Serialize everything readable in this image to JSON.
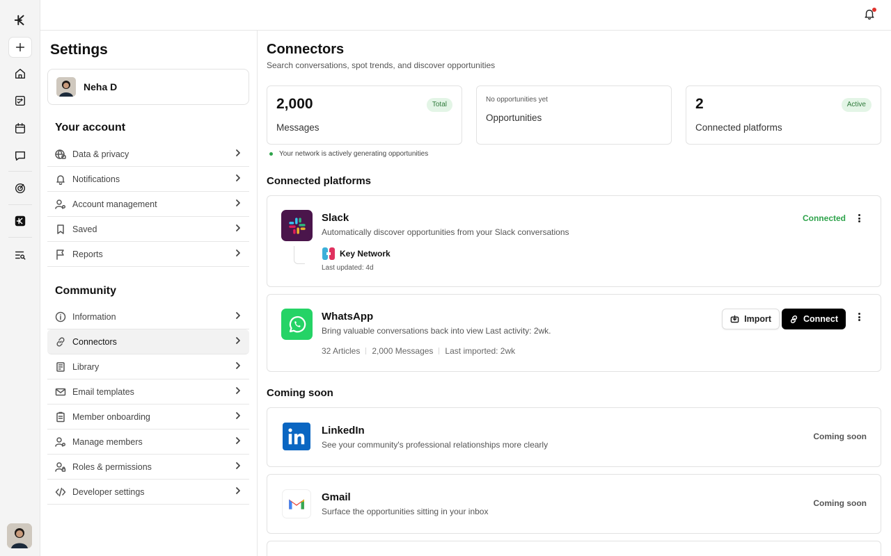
{
  "settings": {
    "title": "Settings",
    "user_name": "Neha D",
    "your_account_title": "Your account",
    "account_items": [
      {
        "label": "Data & privacy",
        "icon": "globe-lock-icon"
      },
      {
        "label": "Notifications",
        "icon": "bell-icon"
      },
      {
        "label": "Account management",
        "icon": "user-gear-icon"
      },
      {
        "label": "Saved",
        "icon": "bookmark-icon"
      },
      {
        "label": "Reports",
        "icon": "flag-icon"
      }
    ],
    "community_title": "Community",
    "community_items": [
      {
        "label": "Information",
        "icon": "info-icon"
      },
      {
        "label": "Connectors",
        "icon": "link-icon",
        "active": true
      },
      {
        "label": "Library",
        "icon": "book-icon"
      },
      {
        "label": "Email templates",
        "icon": "mail-icon"
      },
      {
        "label": "Member onboarding",
        "icon": "clipboard-icon"
      },
      {
        "label": "Manage members",
        "icon": "user-gear-icon"
      },
      {
        "label": "Roles & permissions",
        "icon": "user-lock-icon"
      },
      {
        "label": "Developer settings",
        "icon": "code-icon"
      }
    ]
  },
  "main": {
    "title": "Connectors",
    "subtitle": "Search conversations, spot trends, and discover opportunities",
    "stats": {
      "messages_value": "2,000",
      "messages_label": "Messages",
      "messages_badge": "Total",
      "opps_note": "No opportunities yet",
      "opps_label": "Opportunities",
      "platforms_value": "2",
      "platforms_label": "Connected platforms",
      "platforms_badge": "Active"
    },
    "network_note": "Your network is actively generating opportunities",
    "connected_title": "Connected platforms",
    "slack": {
      "name": "Slack",
      "desc": "Automatically discover opportunities from your Slack conversations",
      "status": "Connected",
      "workspace": "Key Network",
      "updated": "Last updated: 4d"
    },
    "whatsapp": {
      "name": "WhatsApp",
      "desc": "Bring valuable conversations back into view Last activity: 2wk.",
      "import_label": "Import",
      "connect_label": "Connect",
      "articles": "32 Articles",
      "messages": "2,000 Messages",
      "imported": "Last imported: 2wk"
    },
    "coming_title": "Coming soon",
    "linkedin": {
      "name": "LinkedIn",
      "desc": "See your community's professional relationships more clearly",
      "status": "Coming soon"
    },
    "gmail": {
      "name": "Gmail",
      "desc": "Surface the opportunities sitting in your inbox",
      "status": "Coming soon"
    }
  },
  "colors": {
    "accent_green": "#2ea34b",
    "badge_bg": "#e3f5e6",
    "slack_bg": "#4a154b",
    "whatsapp_bg": "#25d366",
    "linkedin_bg": "#0a66c2"
  }
}
